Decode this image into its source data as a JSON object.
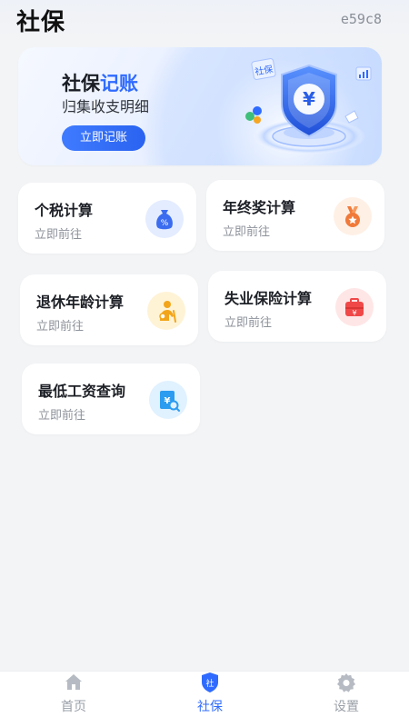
{
  "header": {
    "title": "社保",
    "code": "e59c8"
  },
  "banner": {
    "title_main": "社保",
    "title_accent": "记账",
    "subtitle": "归集收支明细",
    "button_label": "立即记账",
    "badge_text": "社保",
    "coin_symbol": "¥"
  },
  "cards": [
    {
      "title": "个税计算",
      "sub": "立即前往",
      "icon": "tax-bag-icon",
      "icon_bg": "#e4ecff",
      "icon_color": "#3b6cf0"
    },
    {
      "title": "年终奖计算",
      "sub": "立即前往",
      "icon": "medal-icon",
      "icon_bg": "#fff0e6",
      "icon_color": "#f07a3a"
    },
    {
      "title": "退休年龄计算",
      "sub": "立即前往",
      "icon": "retiree-icon",
      "icon_bg": "#fff3d6",
      "icon_color": "#f2a51a"
    },
    {
      "title": "失业保险计算",
      "sub": "立即前往",
      "icon": "briefcase-icon",
      "icon_bg": "#ffe6e6",
      "icon_color": "#f04848"
    },
    {
      "title": "最低工资查询",
      "sub": "立即前往",
      "icon": "wage-search-icon",
      "icon_bg": "#e0f1ff",
      "icon_color": "#2b9cf0"
    }
  ],
  "tabbar": {
    "items": [
      {
        "label": "首页",
        "icon": "home-icon",
        "active": false
      },
      {
        "label": "社保",
        "icon": "shield-icon",
        "active": true,
        "icon_text": "社"
      },
      {
        "label": "设置",
        "icon": "gear-icon",
        "active": false
      }
    ]
  },
  "colors": {
    "accent": "#2f6bff",
    "background": "#f3f4f6",
    "card": "#ffffff",
    "muted_text": "#8d929a"
  }
}
